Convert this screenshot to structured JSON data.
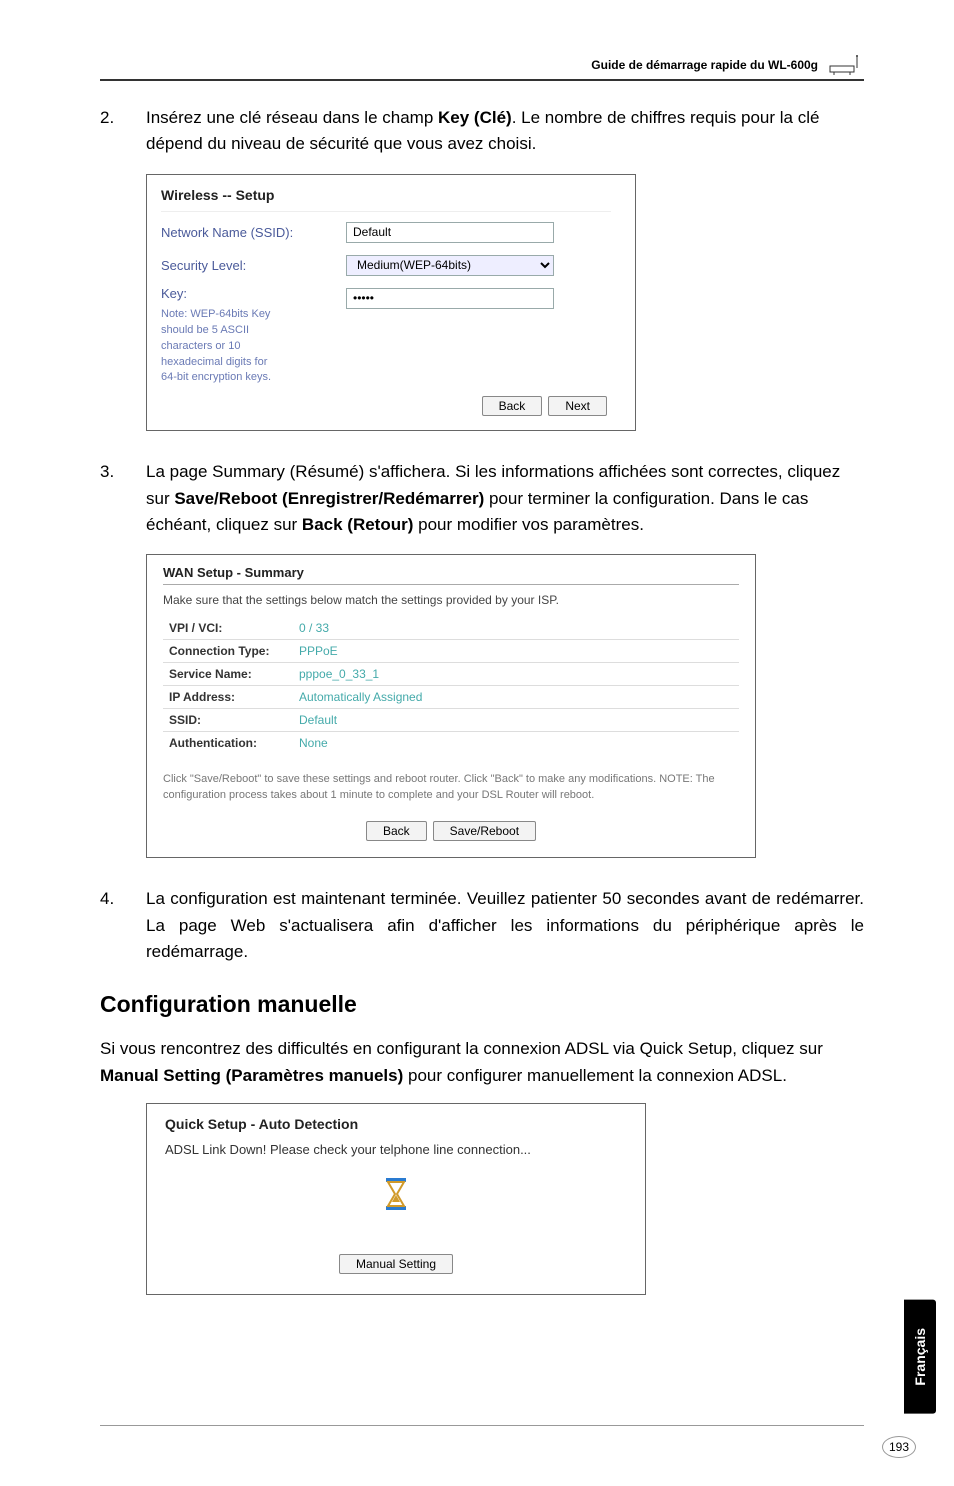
{
  "header": {
    "title": "Guide de démarrage rapide du WL-600g"
  },
  "step2": {
    "num": "2.",
    "pre": "Insérez une clé réseau dans le champ ",
    "bold": "Key (Clé)",
    "post": ". Le nombre de chiffres requis pour la clé dépend du niveau de sécurité que vous avez choisi."
  },
  "shot1": {
    "title": "Wireless -- Setup",
    "ssid_label": "Network Name (SSID):",
    "ssid_value": "Default",
    "sec_label": "Security Level:",
    "sec_value": "Medium(WEP-64bits)",
    "key_label": "Key:",
    "key_value": "•••••",
    "note": "Note: WEP-64bits Key should be 5 ASCII characters or 10 hexadecimal digits for 64-bit encryption keys.",
    "back": "Back",
    "next": "Next"
  },
  "step3": {
    "num": "3.",
    "t1": "La page Summary (Résumé) s'affichera. Si les informations affichées sont correctes, cliquez sur ",
    "b1": "Save/Reboot (Enregistrer/Redémarrer)",
    "t2": " pour terminer la configuration. Dans le cas échéant, cliquez sur ",
    "b2": "Back (Retour)",
    "t3": " pour modifier vos paramètres."
  },
  "shot2": {
    "title": "WAN Setup - Summary",
    "sub": "Make sure that the settings below match the settings provided by your ISP.",
    "rows": [
      {
        "k": "VPI / VCI:",
        "v": "0 / 33"
      },
      {
        "k": "Connection Type:",
        "v": "PPPoE"
      },
      {
        "k": "Service Name:",
        "v": "pppoe_0_33_1"
      },
      {
        "k": "IP Address:",
        "v": "Automatically Assigned"
      },
      {
        "k": "SSID:",
        "v": "Default"
      },
      {
        "k": "Authentication:",
        "v": "None"
      }
    ],
    "note": "Click \"Save/Reboot\" to save these settings and reboot router. Click \"Back\" to make any modifications. NOTE: The configuration process takes about 1 minute to complete and your DSL Router will reboot.",
    "back": "Back",
    "save": "Save/Reboot"
  },
  "step4": {
    "num": "4.",
    "text": "La configuration est maintenant terminée. Veuillez patienter 50 secondes avant de redémarrer. La page Web s'actualisera afin d'afficher les informations du périphérique après le redémarrage."
  },
  "section_title": "Configuration manuelle",
  "manual_para": {
    "t1": "Si vous rencontrez des difficultés en configurant la connexion ADSL via  Quick Setup, cliquez sur ",
    "b1": "Manual Setting (Paramètres manuels)",
    "t2": " pour configurer manuellement la connexion ADSL."
  },
  "shot3": {
    "title": "Quick Setup - Auto Detection",
    "msg": "ADSL Link Down! Please check your telphone line connection...",
    "btn": "Manual Setting"
  },
  "side_tab": "Français",
  "page_number": "193"
}
